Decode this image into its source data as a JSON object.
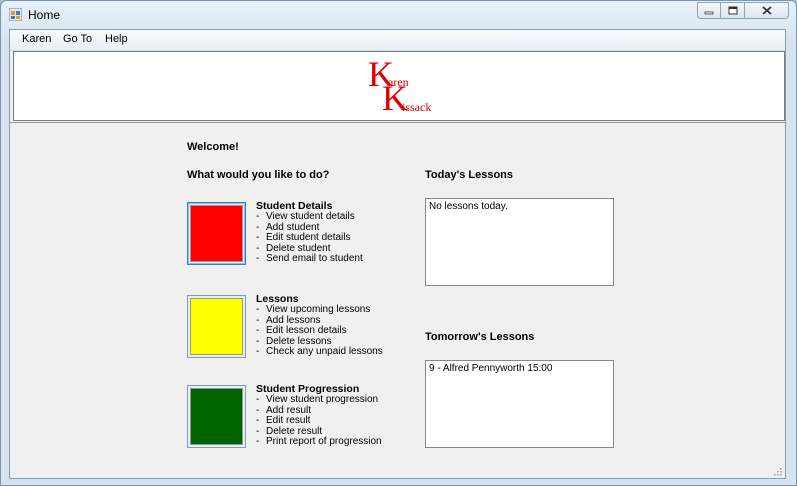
{
  "window": {
    "title": "Home"
  },
  "menu": {
    "items": [
      "Karen",
      "Go To",
      "Help"
    ]
  },
  "logo": {
    "big1": "K",
    "small1": "aren",
    "big2": "K",
    "small2": "issack"
  },
  "main": {
    "welcome": "Welcome!",
    "prompt": "What would you like to do?",
    "sections": [
      {
        "title": "Student Details",
        "color": "#ff0000",
        "items": [
          "View student details",
          "Add student",
          "Edit student details",
          "Delete student",
          "Send email to student"
        ]
      },
      {
        "title": "Lessons",
        "color": "#ffff00",
        "items": [
          "View upcoming lessons",
          "Add lessons",
          "Edit lesson details",
          "Delete lessons",
          "Check any unpaid lessons"
        ]
      },
      {
        "title": "Student Progression",
        "color": "#006400",
        "items": [
          "View student progression",
          "Add result",
          "Edit result",
          "Delete result",
          "Print report of progression"
        ]
      }
    ],
    "dash": "-",
    "today": {
      "title": "Today's Lessons",
      "entries": [
        "No lessons today."
      ]
    },
    "tomorrow": {
      "title": "Tomorrow's Lessons",
      "entries": [
        "9 - Alfred Pennyworth 15:00"
      ]
    }
  }
}
